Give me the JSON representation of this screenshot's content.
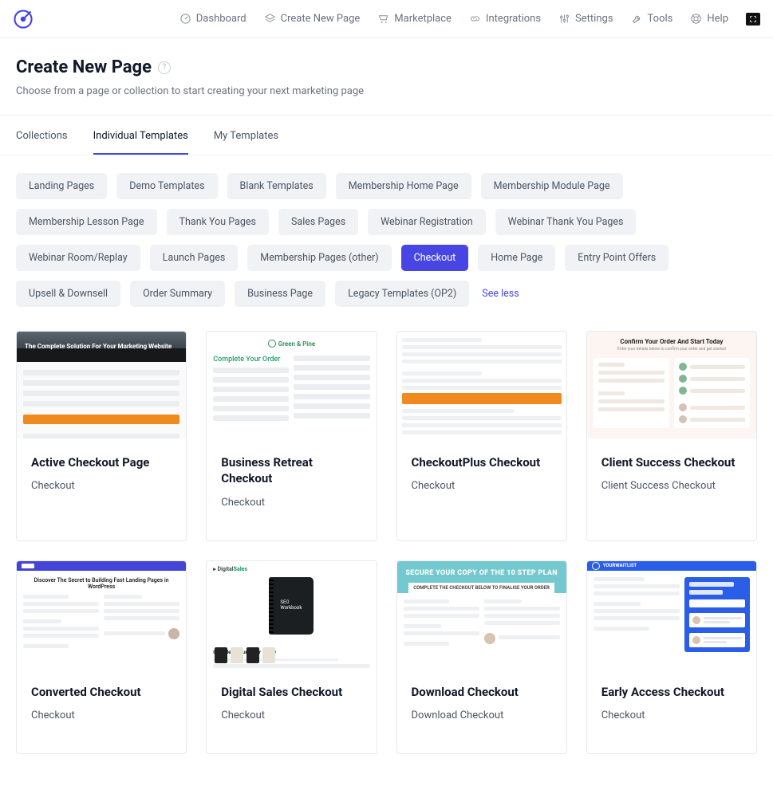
{
  "nav": {
    "dashboard": "Dashboard",
    "create": "Create New Page",
    "marketplace": "Marketplace",
    "integrations": "Integrations",
    "settings": "Settings",
    "tools": "Tools",
    "help": "Help"
  },
  "page": {
    "title": "Create New Page",
    "subtitle": "Choose from a page or collection to start creating your next marketing page"
  },
  "tabs": {
    "collections": "Collections",
    "individual": "Individual Templates",
    "my": "My Templates"
  },
  "filters": [
    "Landing Pages",
    "Demo Templates",
    "Blank Templates",
    "Membership Home Page",
    "Membership Module Page",
    "Membership Lesson Page",
    "Thank You Pages",
    "Sales Pages",
    "Webinar Registration",
    "Webinar Thank You Pages",
    "Webinar Room/Replay",
    "Launch Pages",
    "Membership Pages (other)",
    "Checkout",
    "Home Page",
    "Entry Point Offers",
    "Upsell & Downsell",
    "Order Summary",
    "Business Page",
    "Legacy Templates (OP2)"
  ],
  "filters_active": "Checkout",
  "see_less": "See less",
  "cards": [
    {
      "title": "Active Checkout Page",
      "category": "Checkout"
    },
    {
      "title": "Business Retreat Checkout",
      "category": "Checkout"
    },
    {
      "title": "CheckoutPlus Checkout",
      "category": "Checkout"
    },
    {
      "title": "Client Success Checkout",
      "category": "Client Success Checkout"
    },
    {
      "title": "Converted Checkout",
      "category": "Checkout"
    },
    {
      "title": "Digital Sales Checkout",
      "category": "Checkout"
    },
    {
      "title": "Download Checkout",
      "category": "Download Checkout"
    },
    {
      "title": "Early Access Checkout",
      "category": "Checkout"
    }
  ],
  "thumbs": {
    "active_title": "The Complete Solution For Your Marketing Website",
    "biz_brand": "Green & Pine",
    "biz_heading": "Complete Your Order",
    "client_heading": "Confirm Your Order And Start Today",
    "conv_heading": "Discover The Secret to Building Fast Landing Pages in WordPress",
    "dig_brand_a": "Digital",
    "dig_brand_b": "Sales",
    "dig_form_heading": "Complete your order below",
    "down_h1": "SECURE YOUR COPY OF THE 10 STEP PLAN",
    "down_h2": "COMPLETE THE CHECKOUT BELOW TO FINALISE YOUR ORDER",
    "early_brand": "YOURWAITLIST"
  }
}
